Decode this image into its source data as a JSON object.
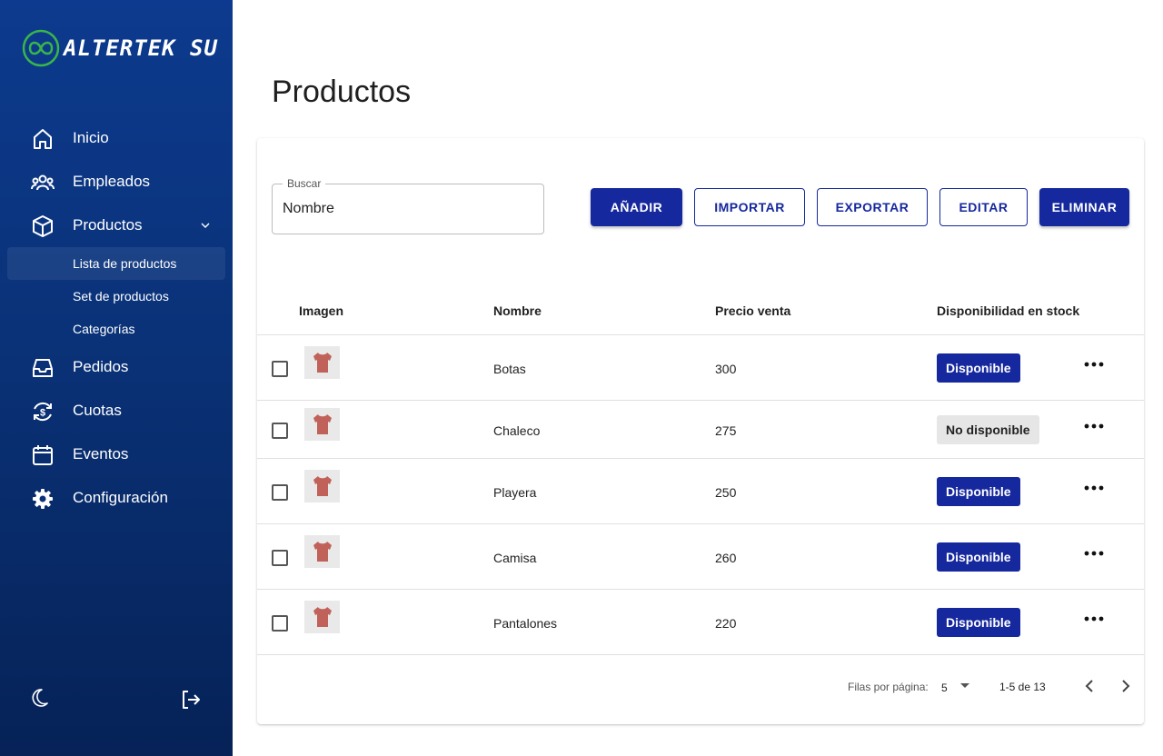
{
  "app": {
    "logo_text": "ALTERTEK SU"
  },
  "sidebar": {
    "items": [
      {
        "label": "Inicio",
        "icon": "home-icon"
      },
      {
        "label": "Empleados",
        "icon": "people-icon"
      },
      {
        "label": "Productos",
        "icon": "box-icon"
      },
      {
        "label": "Pedidos",
        "icon": "inbox-icon"
      },
      {
        "label": "Cuotas",
        "icon": "dollar-cycle-icon"
      },
      {
        "label": "Eventos",
        "icon": "calendar-icon"
      },
      {
        "label": "Configuración",
        "icon": "gear-icon"
      }
    ],
    "sub_items": [
      {
        "label": "Lista de productos",
        "active": true
      },
      {
        "label": "Set de productos",
        "active": false
      },
      {
        "label": "Categorías",
        "active": false
      }
    ],
    "theme_icon": "moon-icon",
    "logout_icon": "logout-icon"
  },
  "page": {
    "title": "Productos"
  },
  "search": {
    "label": "Buscar",
    "value": "Nombre"
  },
  "toolbar": {
    "add_label": "AÑADIR",
    "import_label": "IMPORTAR",
    "export_label": "EXPORTAR",
    "edit_label": "EDITAR",
    "delete_label": "ELIMINAR"
  },
  "table": {
    "headers": [
      "Imagen",
      "Nombre",
      "Precio venta",
      "Disponibilidad en stock"
    ],
    "rows": [
      {
        "name": "Botas",
        "price": "300",
        "stock": "Disponible",
        "available": true
      },
      {
        "name": "Chaleco",
        "price": "275",
        "stock": "No disponible",
        "available": false
      },
      {
        "name": "Playera",
        "price": "250",
        "stock": "Disponible",
        "available": true
      },
      {
        "name": "Camisa",
        "price": "260",
        "stock": "Disponible",
        "available": true
      },
      {
        "name": "Pantalones",
        "price": "220",
        "stock": "Disponible",
        "available": true
      }
    ]
  },
  "pagination": {
    "rows_per_page_label": "Filas por página:",
    "rows_per_page": "5",
    "range": "1-5 de 13"
  },
  "colors": {
    "primary": "#16289d",
    "sidebar": "#0a3278",
    "product_tint": "#c0625a"
  }
}
